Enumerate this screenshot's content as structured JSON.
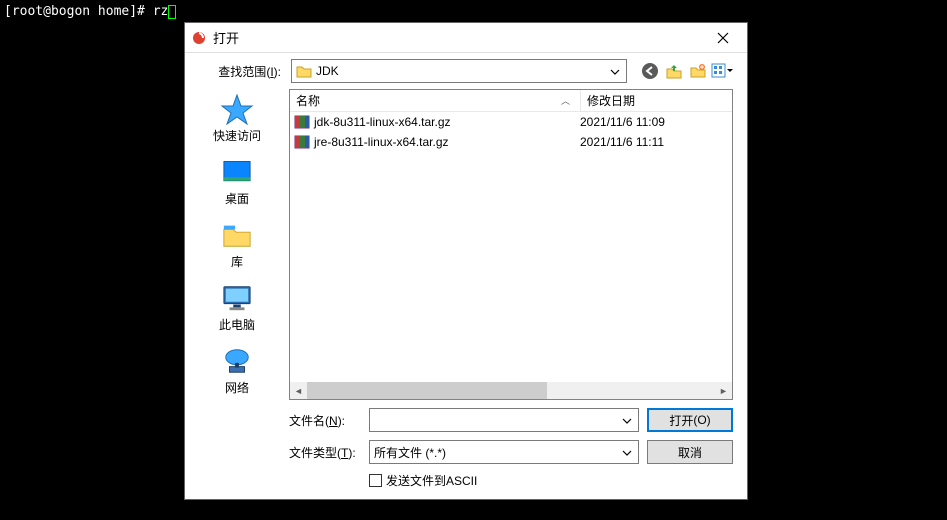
{
  "terminal": {
    "prompt": "[root@bogon home]# ",
    "command": "rz"
  },
  "dialog": {
    "title": "打开",
    "lookin_label": "查找范围",
    "lookin_hotkey": "I",
    "lookin_value": "JDK"
  },
  "places": [
    {
      "label": "快速访问"
    },
    {
      "label": "桌面"
    },
    {
      "label": "库"
    },
    {
      "label": "此电脑"
    },
    {
      "label": "网络"
    }
  ],
  "columns": {
    "name": "名称",
    "date": "修改日期"
  },
  "files": [
    {
      "name": "jdk-8u311-linux-x64.tar.gz",
      "date": "2021/11/6 11:09"
    },
    {
      "name": "jre-8u311-linux-x64.tar.gz",
      "date": "2021/11/6 11:11"
    }
  ],
  "fields": {
    "filename_label": "文件名",
    "filename_hotkey": "N",
    "filename_value": "",
    "filetype_label": "文件类型",
    "filetype_hotkey": "T",
    "filetype_value": "所有文件 (*.*)"
  },
  "buttons": {
    "open": "打开",
    "open_hotkey": "O",
    "cancel": "取消"
  },
  "checkbox": {
    "label": "发送文件到ASCII"
  }
}
